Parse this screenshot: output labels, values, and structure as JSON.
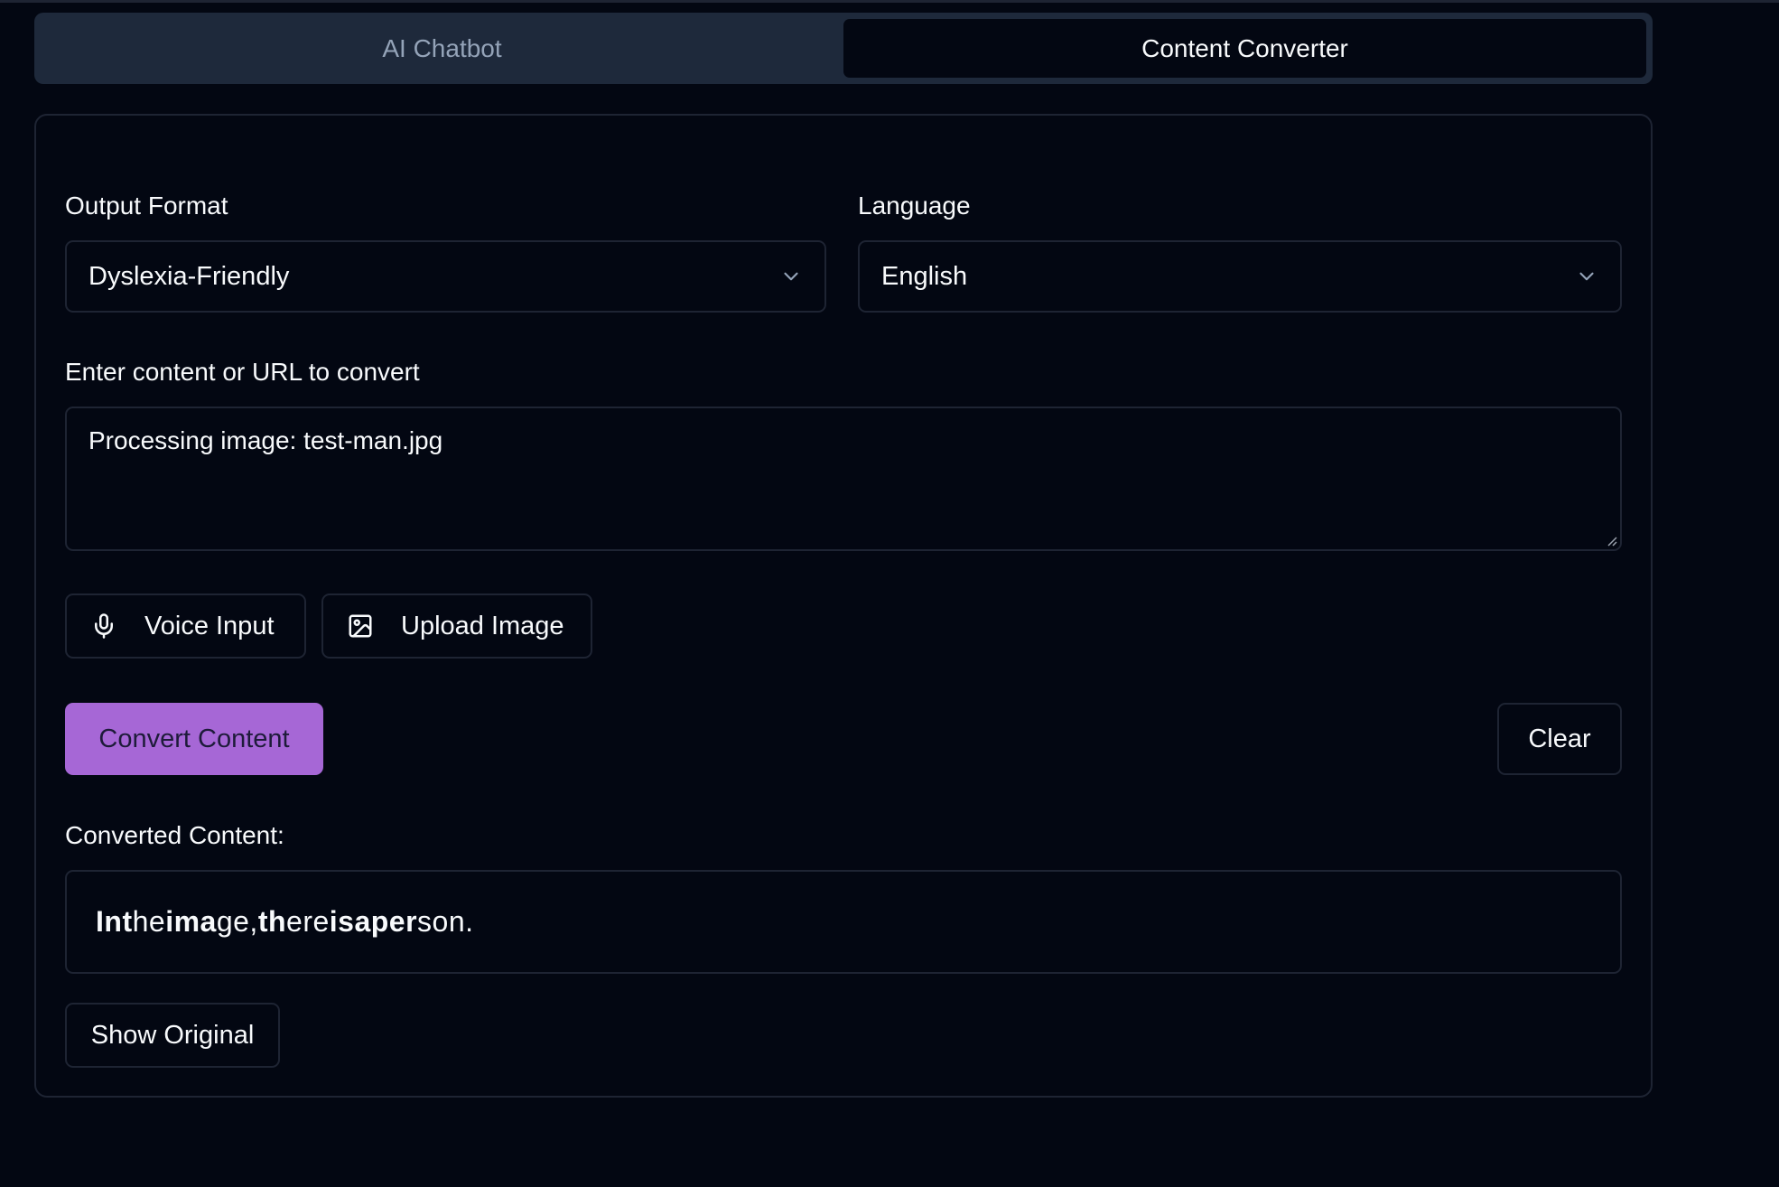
{
  "tabs": [
    {
      "label": "AI Chatbot",
      "active": false
    },
    {
      "label": "Content Converter",
      "active": true
    }
  ],
  "form": {
    "output_format": {
      "label": "Output Format",
      "value": "Dyslexia-Friendly"
    },
    "language": {
      "label": "Language",
      "value": "English"
    },
    "content": {
      "label": "Enter content or URL to convert",
      "value": "Processing image: test-man.jpg"
    }
  },
  "buttons": {
    "voice_input": "Voice Input",
    "upload_image": "Upload Image",
    "convert": "Convert Content",
    "clear": "Clear",
    "show_original": "Show Original"
  },
  "result": {
    "label": "Converted Content:",
    "words": [
      {
        "bold": "In",
        "rest": ""
      },
      {
        "bold": "t",
        "rest": "he"
      },
      {
        "bold": "ima",
        "rest": "ge,"
      },
      {
        "bold": "th",
        "rest": "ere"
      },
      {
        "bold": "is",
        "rest": ""
      },
      {
        "bold": "a",
        "rest": ""
      },
      {
        "bold": "per",
        "rest": "son."
      }
    ]
  },
  "icons": {
    "output_format_chevron": "chevron-down-icon",
    "language_chevron": "chevron-down-icon",
    "voice": "microphone-icon",
    "upload": "image-icon"
  },
  "colors": {
    "background": "#030712",
    "border": "#1e2433",
    "tab_bar": "#1e293b",
    "accent": "#a667d6"
  }
}
